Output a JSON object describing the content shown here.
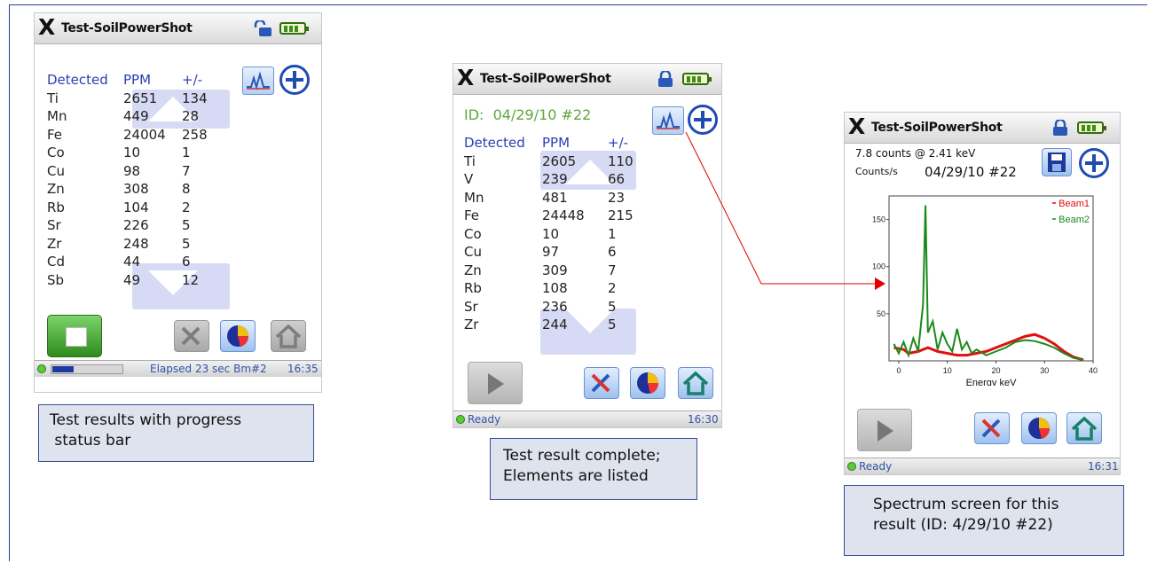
{
  "screens": [
    {
      "app_title": "Test-SoilPowerShot",
      "table": {
        "headers": [
          "Detected",
          "PPM",
          "+/-"
        ],
        "rows": [
          [
            "Ti",
            "2651",
            "134"
          ],
          [
            "Mn",
            "449",
            "28"
          ],
          [
            "Fe",
            "24004",
            "258"
          ],
          [
            "Co",
            "10",
            "1"
          ],
          [
            "Cu",
            "98",
            "7"
          ],
          [
            "Zn",
            "308",
            "8"
          ],
          [
            "Rb",
            "104",
            "2"
          ],
          [
            "Sr",
            "226",
            "5"
          ],
          [
            "Zr",
            "248",
            "5"
          ],
          [
            "Cd",
            "44",
            "6"
          ],
          [
            "Sb",
            "49",
            "12"
          ]
        ]
      },
      "status": {
        "text": "Elapsed 23 sec Bm#2",
        "time": "16:35"
      },
      "caption": [
        "Test results with progress",
        " status bar"
      ]
    },
    {
      "app_title": "Test-SoilPowerShot",
      "id_line": "ID:  04/29/10 #22",
      "table": {
        "headers": [
          "Detected",
          "PPM",
          "+/-"
        ],
        "rows": [
          [
            "Ti",
            "2605",
            "110"
          ],
          [
            "V",
            "239",
            "66"
          ],
          [
            "Mn",
            "481",
            "23"
          ],
          [
            "Fe",
            "24448",
            "215"
          ],
          [
            "Co",
            "10",
            "1"
          ],
          [
            "Cu",
            "97",
            "6"
          ],
          [
            "Zn",
            "309",
            "7"
          ],
          [
            "Rb",
            "108",
            "2"
          ],
          [
            "Sr",
            "236",
            "5"
          ],
          [
            "Zr",
            "244",
            "5"
          ]
        ]
      },
      "status": {
        "text": "Ready",
        "time": "16:30"
      },
      "caption": [
        "Test result complete;",
        "Elements are listed"
      ]
    },
    {
      "app_title": "Test-SoilPowerShot",
      "counts_line": "7.8 counts @ 2.41 keV",
      "y_unit": "Counts/s",
      "id_line": "04/29/10 #22",
      "status": {
        "text": "Ready",
        "time": "16:31"
      },
      "caption": [
        "Spectrum screen for this",
        "result (ID: 4/29/10 #22)"
      ]
    }
  ],
  "chart_data": {
    "type": "line",
    "xlabel": "Energy keV",
    "ylabel": "",
    "x_ticks": [
      "0",
      "10",
      "20",
      "30",
      "40"
    ],
    "y_ticks": [
      "50",
      "100",
      "150"
    ],
    "xlim": [
      -2,
      40
    ],
    "ylim": [
      0,
      175
    ],
    "legend_position": "top-right",
    "series": [
      {
        "name": "Beam1",
        "color": "#e01010",
        "x": [
          -1,
          1,
          2,
          4,
          6,
          8,
          10,
          12,
          14,
          16,
          18,
          20,
          22,
          24,
          26,
          28,
          30,
          32,
          34,
          36,
          38
        ],
        "values": [
          14,
          12,
          8,
          10,
          14,
          10,
          8,
          6,
          6,
          8,
          10,
          14,
          18,
          22,
          26,
          28,
          24,
          18,
          10,
          4,
          1
        ]
      },
      {
        "name": "Beam2",
        "color": "#1a8a1a",
        "x": [
          -1,
          0,
          1,
          2,
          3,
          4,
          5,
          5.5,
          6,
          7,
          8,
          9,
          10,
          11,
          12,
          13,
          14,
          15,
          16,
          18,
          20,
          22,
          24,
          26,
          28,
          30,
          32,
          34,
          36,
          38
        ],
        "values": [
          18,
          8,
          20,
          6,
          24,
          10,
          60,
          165,
          30,
          42,
          12,
          30,
          18,
          10,
          34,
          12,
          20,
          8,
          12,
          6,
          10,
          14,
          20,
          22,
          21,
          18,
          14,
          8,
          3,
          1
        ]
      }
    ]
  },
  "colors": {
    "frame_border": "#2b3b9c",
    "annotation_arrow": "#e00000",
    "caption_bg": "#dfe3ee"
  }
}
